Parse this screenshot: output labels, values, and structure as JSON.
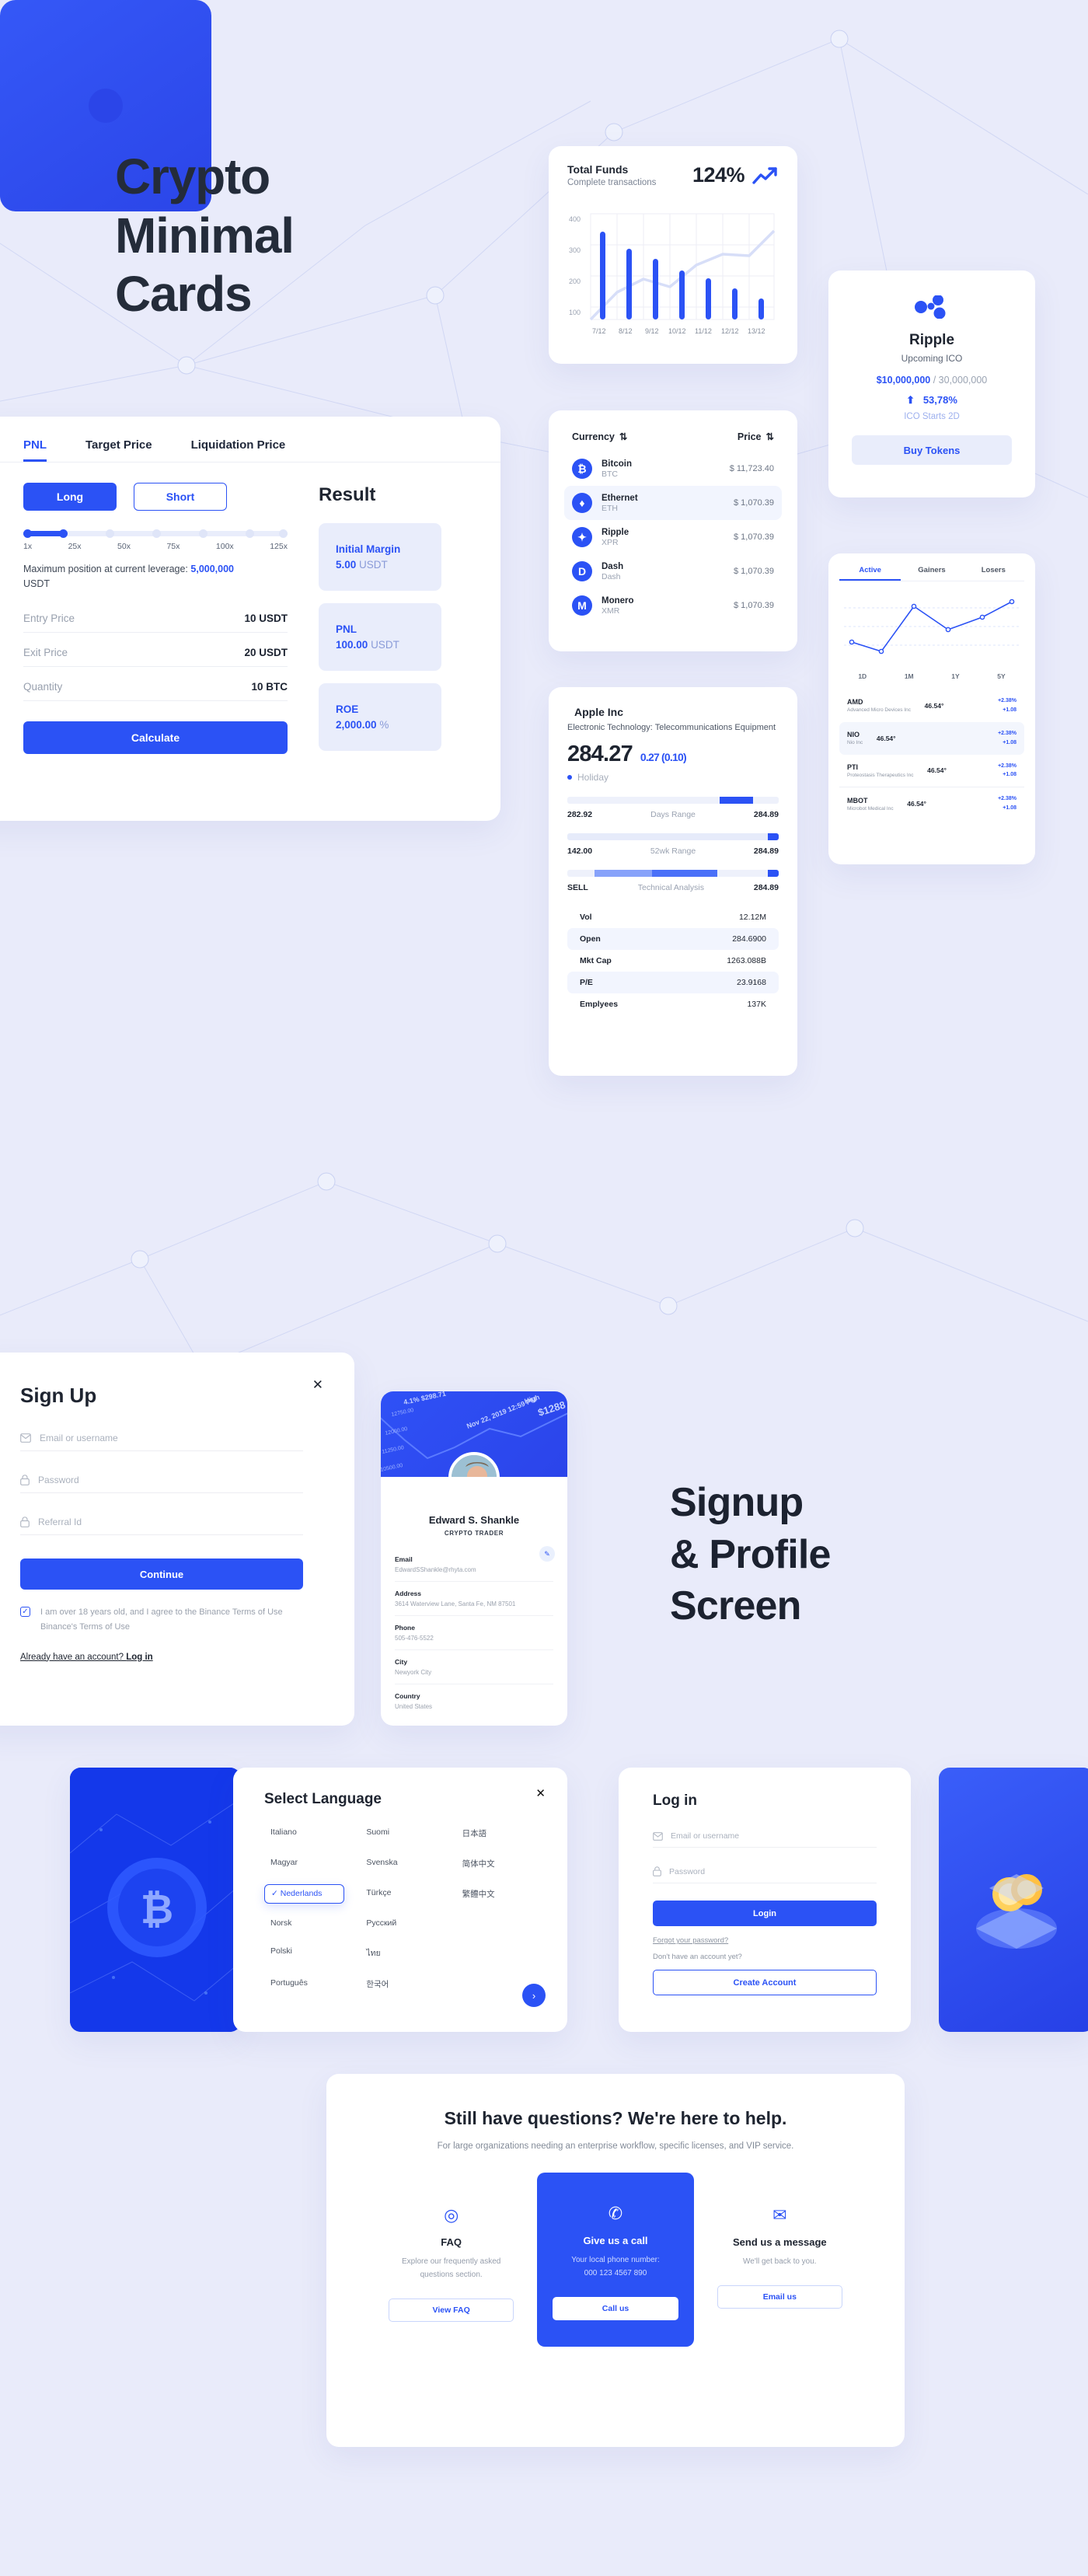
{
  "hero": {
    "title_lines": [
      "Crypto",
      "Minimal",
      "Cards"
    ]
  },
  "signup_heading": {
    "lines": [
      "Signup",
      "&  Profile",
      "Screen"
    ]
  },
  "pnl": {
    "tabs": [
      "PNL",
      "Target Price",
      "Liquidation Price"
    ],
    "active_tab": "PNL",
    "long_label": "Long",
    "short_label": "Short",
    "leverage_ticks": [
      "1x",
      "25x",
      "50x",
      "75x",
      "100x",
      "125x"
    ],
    "max_position_prefix": "Maximum position at current leverage:",
    "max_position_value": "5,000,000",
    "max_position_unit": "USDT",
    "fields": [
      {
        "label": "Entry Price",
        "value": "10 USDT"
      },
      {
        "label": "Exit Price",
        "value": "20 USDT"
      },
      {
        "label": "Quantity",
        "value": "10 BTC"
      }
    ],
    "calculate_label": "Calculate",
    "result_title": "Result",
    "results": [
      {
        "name": "Initial Margin",
        "num": "5.00",
        "unit": "USDT"
      },
      {
        "name": "PNL",
        "num": "100.00",
        "unit": "USDT"
      },
      {
        "name": "ROE",
        "num": "2,000.00",
        "unit": "%"
      }
    ]
  },
  "chart_data": {
    "type": "bar",
    "title": "Total Funds",
    "subtitle": "Complete transactions",
    "headline_value": "124%",
    "categories": [
      "7/12",
      "8/12",
      "9/12",
      "10/12",
      "11/12",
      "12/12",
      "13/12"
    ],
    "values": [
      333,
      268,
      228,
      184,
      157,
      116,
      78
    ],
    "series": [
      {
        "name": "bars",
        "values": [
          333,
          268,
          228,
          184,
          157,
          116,
          78
        ]
      },
      {
        "name": "trend-line",
        "values": [
          100,
          212,
          250,
          224,
          285,
          310,
          307,
          372
        ]
      }
    ],
    "yticks": [
      100,
      200,
      300,
      400
    ],
    "ylim": [
      0,
      420
    ],
    "xlabel": "",
    "ylabel": "",
    "grid": true,
    "legend": "none"
  },
  "currency": {
    "col_currency": "Currency",
    "col_price": "Price",
    "rows": [
      {
        "glyph": "₿",
        "name": "Bitcoin",
        "symbol": "BTC",
        "price": "$ 11,723.40",
        "selected": false
      },
      {
        "glyph": "♦",
        "name": "Ethernet",
        "symbol": "ETH",
        "price": "$ 1,070.39",
        "selected": true
      },
      {
        "glyph": "✦",
        "name": "Ripple",
        "symbol": "XPR",
        "price": "$ 1,070.39",
        "selected": false
      },
      {
        "glyph": "D",
        "name": "Dash",
        "symbol": "Dash",
        "price": "$ 1,070.39",
        "selected": false
      },
      {
        "glyph": "M",
        "name": "Monero",
        "symbol": "XMR",
        "price": "$ 1,070.39",
        "selected": false
      }
    ]
  },
  "apple": {
    "name": "Apple Inc",
    "category": "Electronic Technology: Telecommunications Equipment",
    "price": "284.27",
    "change": "0.27 (0.10)",
    "status": "Holiday",
    "ranges": [
      {
        "low": "282.92",
        "label": "Days Range",
        "high": "284.89"
      },
      {
        "low": "142.00",
        "label": "52wk Range",
        "high": "284.89"
      },
      {
        "low": "SELL",
        "label": "Technical Analysis",
        "high": "284.89"
      }
    ],
    "stats": [
      {
        "k": "Vol",
        "v": "12.12M"
      },
      {
        "k": "Open",
        "v": "284.6900"
      },
      {
        "k": "Mkt Cap",
        "v": "1263.088B"
      },
      {
        "k": "P/E",
        "v": "23.9168"
      },
      {
        "k": "Emplyees",
        "v": "137K"
      }
    ]
  },
  "ripple": {
    "name": "Ripple",
    "subtitle": "Upcoming ICO",
    "raised": "$10,000,000",
    "goal": "/ 30,000,000",
    "percent": "53,78%",
    "starts": "ICO Starts 2D",
    "button": "Buy Tokens"
  },
  "gainers": {
    "tabs": [
      "Active",
      "Gainers",
      "Losers"
    ],
    "active_tab": "Active",
    "xticks": [
      "1D",
      "1M",
      "1Y",
      "5Y"
    ],
    "line_points": [
      28,
      18,
      72,
      44,
      58,
      78
    ],
    "rows": [
      {
        "symbol": "AMD",
        "company": "Advanced Micro Devices Inc",
        "price": "46.54°",
        "pct": "+2.38%",
        "delta": "+1.08"
      },
      {
        "symbol": "NIO",
        "company": "Nio Inc",
        "price": "46.54°",
        "pct": "+2.38%",
        "delta": "+1.08"
      },
      {
        "symbol": "PTI",
        "company": "Proteostasis Therapeutics Inc",
        "price": "46.54°",
        "pct": "+2.38%",
        "delta": "+1.08"
      },
      {
        "symbol": "MBOT",
        "company": "Microbot Medical Inc",
        "price": "46.54°",
        "pct": "+2.38%",
        "delta": "+1.08"
      }
    ]
  },
  "signup": {
    "title": "Sign Up",
    "fields": [
      {
        "icon": "envelope-icon",
        "placeholder": "Email or username"
      },
      {
        "icon": "lock-icon",
        "placeholder": "Password"
      },
      {
        "icon": "lock-icon",
        "placeholder": "Referral Id"
      }
    ],
    "continue_label": "Continue",
    "terms": "I am over 18 years old, and I agree to the Binance Terms of Use Binance's Terms of Use",
    "login_prefix": "Already have an account? ",
    "login_label": "Log in"
  },
  "profile": {
    "name": "Edward S. Shankle",
    "role": "CRYPTO TRADER",
    "rows": [
      {
        "k": "Email",
        "v": "EdwardSShankle@rhyta.com"
      },
      {
        "k": "Address",
        "v": "3614 Waterview Lane, Santa Fe, NM 87501"
      },
      {
        "k": "Phone",
        "v": "505-476-5522"
      },
      {
        "k": "City",
        "v": "Newyork City"
      },
      {
        "k": "Country",
        "v": "United States"
      }
    ],
    "cover_texts": [
      "4.1%  $298.71",
      "Nov 22, 2019 12:59 PM",
      "High",
      "$1288",
      "12750.00",
      "12000.00",
      "11250.00",
      "10500.00"
    ]
  },
  "language": {
    "title": "Select Language",
    "selected": "Nederlands",
    "items": [
      "Italiano",
      "Suomi",
      "日本語",
      "Magyar",
      "Svenska",
      "简体中文",
      "Nederlands",
      "Türkçe",
      "繁體中文",
      "Norsk",
      "Русский",
      "",
      "Polski",
      "ไทย",
      "",
      "Português",
      "한국어",
      ""
    ]
  },
  "login": {
    "title": "Log in",
    "fields": [
      {
        "icon": "envelope-icon",
        "placeholder": "Email or username"
      },
      {
        "icon": "lock-icon",
        "placeholder": "Password"
      }
    ],
    "login_label": "Login",
    "forgot": "Forgot your password?",
    "no_account": "Don't have an account yet?",
    "create_label": "Create Account"
  },
  "help": {
    "title": "Still have questions? We're here to help.",
    "subtitle": "For large organizations needing an enterprise workflow, specific licenses, and VIP service.",
    "columns": [
      {
        "icon": "question-icon",
        "title": "FAQ",
        "text": "Explore our frequently asked questions section.",
        "button": "View FAQ",
        "highlight": false
      },
      {
        "icon": "phone-icon",
        "title": "Give us a call",
        "text": "Your local phone number:\n000 123 4567 890",
        "button": "Call us",
        "highlight": true
      },
      {
        "icon": "envelope-icon",
        "title": "Send us a message",
        "text": "We'll get back to you.",
        "button": "Email us",
        "highlight": false
      }
    ]
  },
  "colors": {
    "accent": "#2b52f5",
    "bg": "#e9ebfa",
    "dark": "#242c3a",
    "muted": "#9aa2b1"
  }
}
